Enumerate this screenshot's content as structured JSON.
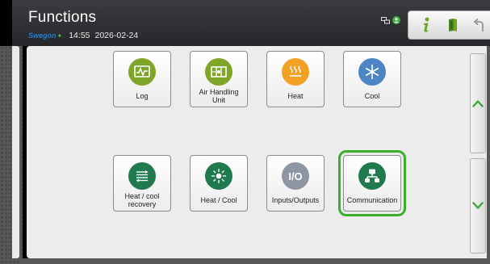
{
  "header": {
    "title": "Functions",
    "brand": "Swegon",
    "time": "14:55",
    "date": "2026-02-24"
  },
  "status_icons": [
    "network-icon",
    "user-status-icon"
  ],
  "toolbar": {
    "info_icon": "info-icon",
    "book_icon": "manual-icon",
    "back_icon": "back-arrow-icon"
  },
  "tiles": [
    {
      "label": "Log",
      "icon": "log-chart-icon",
      "color": "#7fa528"
    },
    {
      "label": "Air Handling\nUnit",
      "icon": "air-handling-unit-icon",
      "color": "#7fa528"
    },
    {
      "label": "Heat",
      "icon": "heat-icon",
      "color": "#f3a125"
    },
    {
      "label": "Cool",
      "icon": "snowflake-icon",
      "color": "#4e86c5"
    },
    {
      "label": "Heat / cool\nrecovery",
      "icon": "heat-recovery-icon",
      "color": "#1f7a4e"
    },
    {
      "label": "Heat / Cool",
      "icon": "heat-cool-icon",
      "color": "#1f7a4e"
    },
    {
      "label": "Inputs/Outputs",
      "icon": "io-icon",
      "color": "#8d96a2"
    },
    {
      "label": "Communication",
      "icon": "communication-network-icon",
      "color": "#1f7a4e"
    }
  ],
  "selected_tile": "Communication",
  "scroll": {
    "up_icon": "chevron-up-icon",
    "down_icon": "chevron-down-icon"
  },
  "colors": {
    "accent_green": "#38b02c",
    "chevron_green": "#3aa83a",
    "header_bg": "#2e3033"
  }
}
